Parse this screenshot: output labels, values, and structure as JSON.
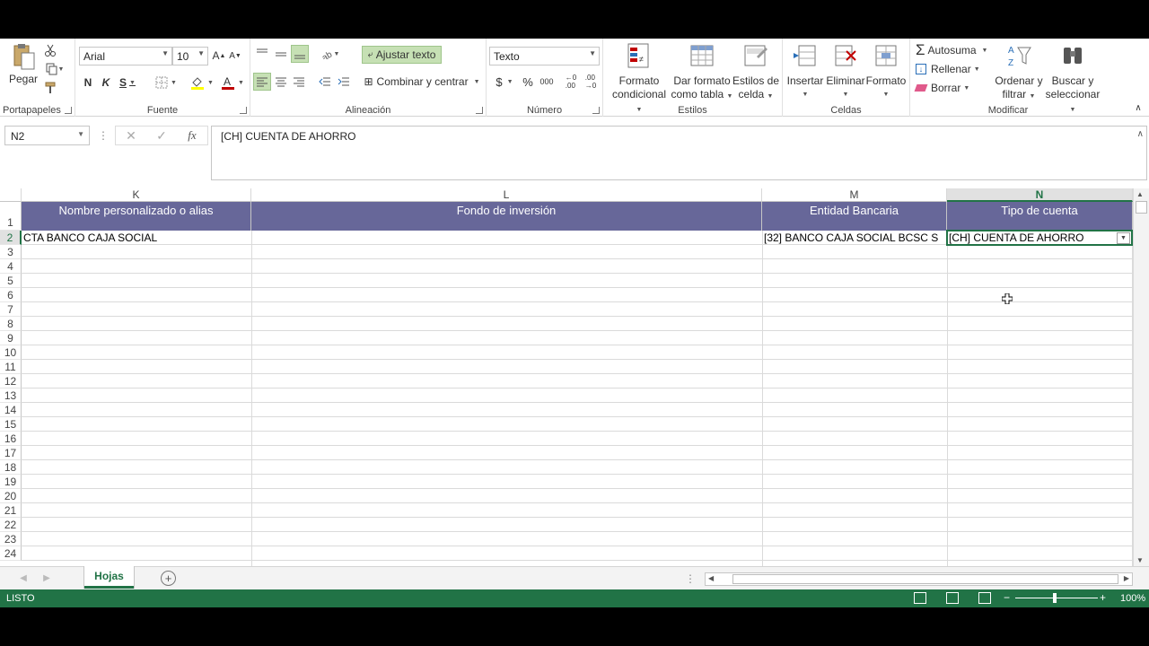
{
  "colors": {
    "accent": "#217346",
    "header_fill": "#676799",
    "status_bar": "#217346"
  },
  "ribbon": {
    "clipboard": {
      "paste_label": "Pegar",
      "group_label": "Portapapeles"
    },
    "font": {
      "font_name": "Arial",
      "font_size": "10",
      "bold": "N",
      "italic": "K",
      "underline": "S",
      "group_label": "Fuente"
    },
    "alignment": {
      "wrap_text": "Ajustar texto",
      "merge_center": "Combinar y centrar",
      "group_label": "Alineación"
    },
    "number": {
      "format": "Texto",
      "currency": "$",
      "percent": "%",
      "thousands": "000",
      "group_label": "Número"
    },
    "styles": {
      "conditional_l1": "Formato",
      "conditional_l2": "condicional",
      "table_l1": "Dar formato",
      "table_l2": "como tabla",
      "cell_l1": "Estilos de",
      "cell_l2": "celda",
      "group_label": "Estilos"
    },
    "cells": {
      "insert": "Insertar",
      "delete": "Eliminar",
      "format": "Formato",
      "group_label": "Celdas"
    },
    "editing": {
      "autosum": "Autosuma",
      "fill": "Rellenar",
      "clear": "Borrar",
      "sort_l1": "Ordenar y",
      "sort_l2": "filtrar",
      "find_l1": "Buscar y",
      "find_l2": "seleccionar",
      "group_label": "Modificar"
    }
  },
  "formula_bar": {
    "name_box": "N2",
    "fx": "fx",
    "content": "[CH] CUENTA DE AHORRO"
  },
  "grid": {
    "columns": [
      "K",
      "L",
      "M",
      "N"
    ],
    "headers": [
      "Nombre personalizado o alias",
      "Fondo de inversión",
      "Entidad Bancaria",
      "Tipo de cuenta"
    ],
    "row2": [
      "CTA BANCO CAJA SOCIAL",
      "",
      "[32] BANCO CAJA SOCIAL BCSC S",
      "[CH] CUENTA DE AHORRO"
    ],
    "row_numbers": [
      "1",
      "2",
      "3",
      "4",
      "5",
      "6",
      "7",
      "8",
      "9",
      "10",
      "11",
      "12",
      "13",
      "14",
      "15",
      "16",
      "17",
      "18",
      "19",
      "20",
      "21",
      "22",
      "23",
      "24"
    ]
  },
  "sheet_tabs": {
    "active": "Hojas"
  },
  "status_bar": {
    "ready": "LISTO",
    "zoom": "100%"
  }
}
